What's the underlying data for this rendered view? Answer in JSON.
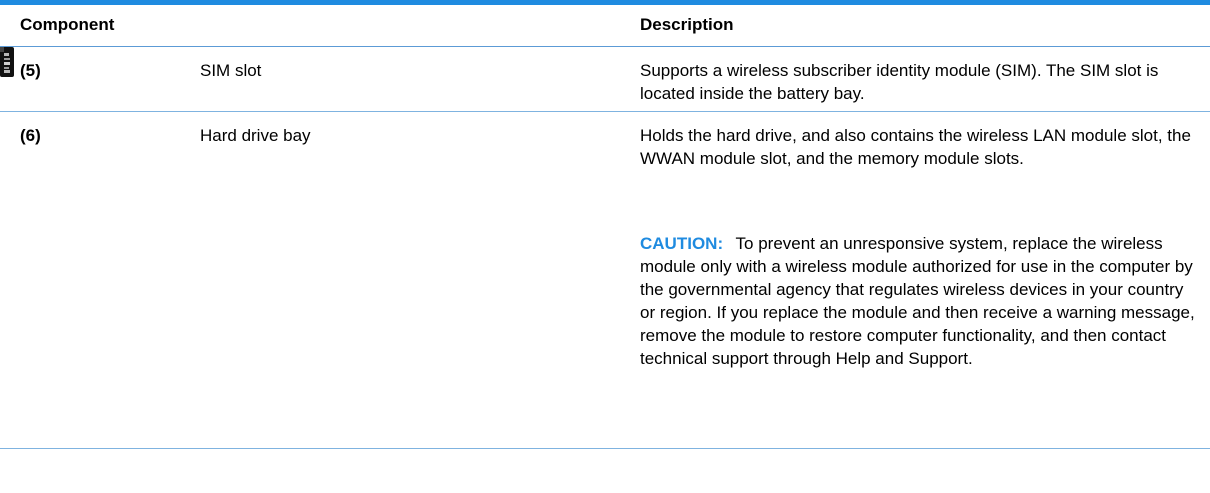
{
  "table": {
    "headers": {
      "component": "Component",
      "description": "Description"
    },
    "rows": [
      {
        "number": "(5)",
        "icon": "sim-card-icon",
        "component": "SIM slot",
        "description": "Supports a wireless subscriber identity module (SIM). The SIM slot is located inside the battery bay."
      },
      {
        "number": "(6)",
        "icon": "",
        "component": "Hard drive bay",
        "description": "Holds the hard drive, and also contains the wireless LAN module slot, the WWAN module slot, and the memory module slots.",
        "caution_label": "CAUTION:",
        "caution_text": "To prevent an unresponsive system, replace the wireless module only with a wireless module authorized for use in the computer by the governmental agency that regulates wireless devices in your country or region. If you replace the module and then receive a warning message, remove the module to restore computer functionality, and then contact technical support through Help and Support."
      }
    ]
  },
  "colors": {
    "accent": "#1f8be0",
    "rule": "#7fb3e0"
  }
}
